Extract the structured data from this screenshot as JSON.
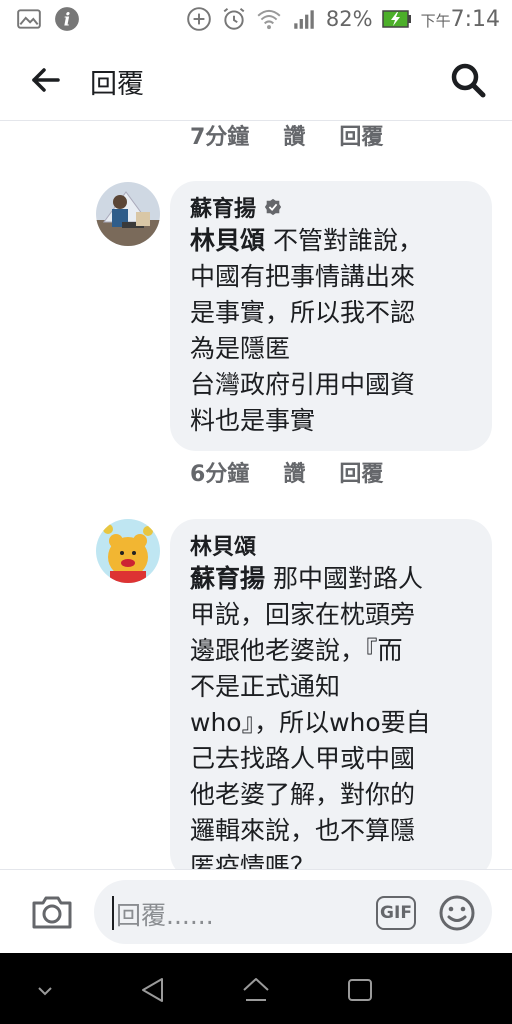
{
  "status_bar": {
    "battery_percent": "82%",
    "time_prefix": "下午",
    "time": "7:14",
    "icons": [
      "gallery-icon",
      "info-icon",
      "data-saver-icon",
      "alarm-icon",
      "wifi-icon",
      "signal-icon",
      "battery-icon"
    ]
  },
  "header": {
    "title": "回覆",
    "back_icon": "back-arrow-icon",
    "search_icon": "search-icon"
  },
  "comments": {
    "prev_meta": {
      "time": "7分鐘",
      "like": "讚",
      "reply": "回覆"
    },
    "items": [
      {
        "author": "蘇育揚",
        "verified": true,
        "mention": "林貝頌",
        "text": " 不管對誰說，\n中國有把事情講出來\n是事實，所以我不認\n為是隱匿\n台灣政府引用中國資\n料也是事實",
        "meta": {
          "time": "6分鐘",
          "like": "讚",
          "reply": "回覆"
        }
      },
      {
        "author": "林貝頌",
        "verified": false,
        "mention": "蘇育揚",
        "text": " 那中國對路人\n甲說，回家在枕頭旁\n邊跟他老婆說，『而\n不是正式通知\nwho』，所以who要自\n己去找路人甲或中國\n他老婆了解，對你的\n邏輯來說，也不算隱\n匿疫情嗎？"
      }
    ]
  },
  "composer": {
    "placeholder": "回覆......",
    "gif_label": "GIF",
    "camera_icon": "camera-icon",
    "emoji_icon": "emoji-icon"
  },
  "nav_bar": {
    "icons": [
      "hide-nav-icon",
      "back-nav-icon",
      "home-nav-icon",
      "recents-nav-icon"
    ]
  },
  "colors": {
    "bubble": "#f0f2f5",
    "meta_text": "#65676b",
    "battery_green": "#4caf2a",
    "text": "#1c1e21"
  }
}
